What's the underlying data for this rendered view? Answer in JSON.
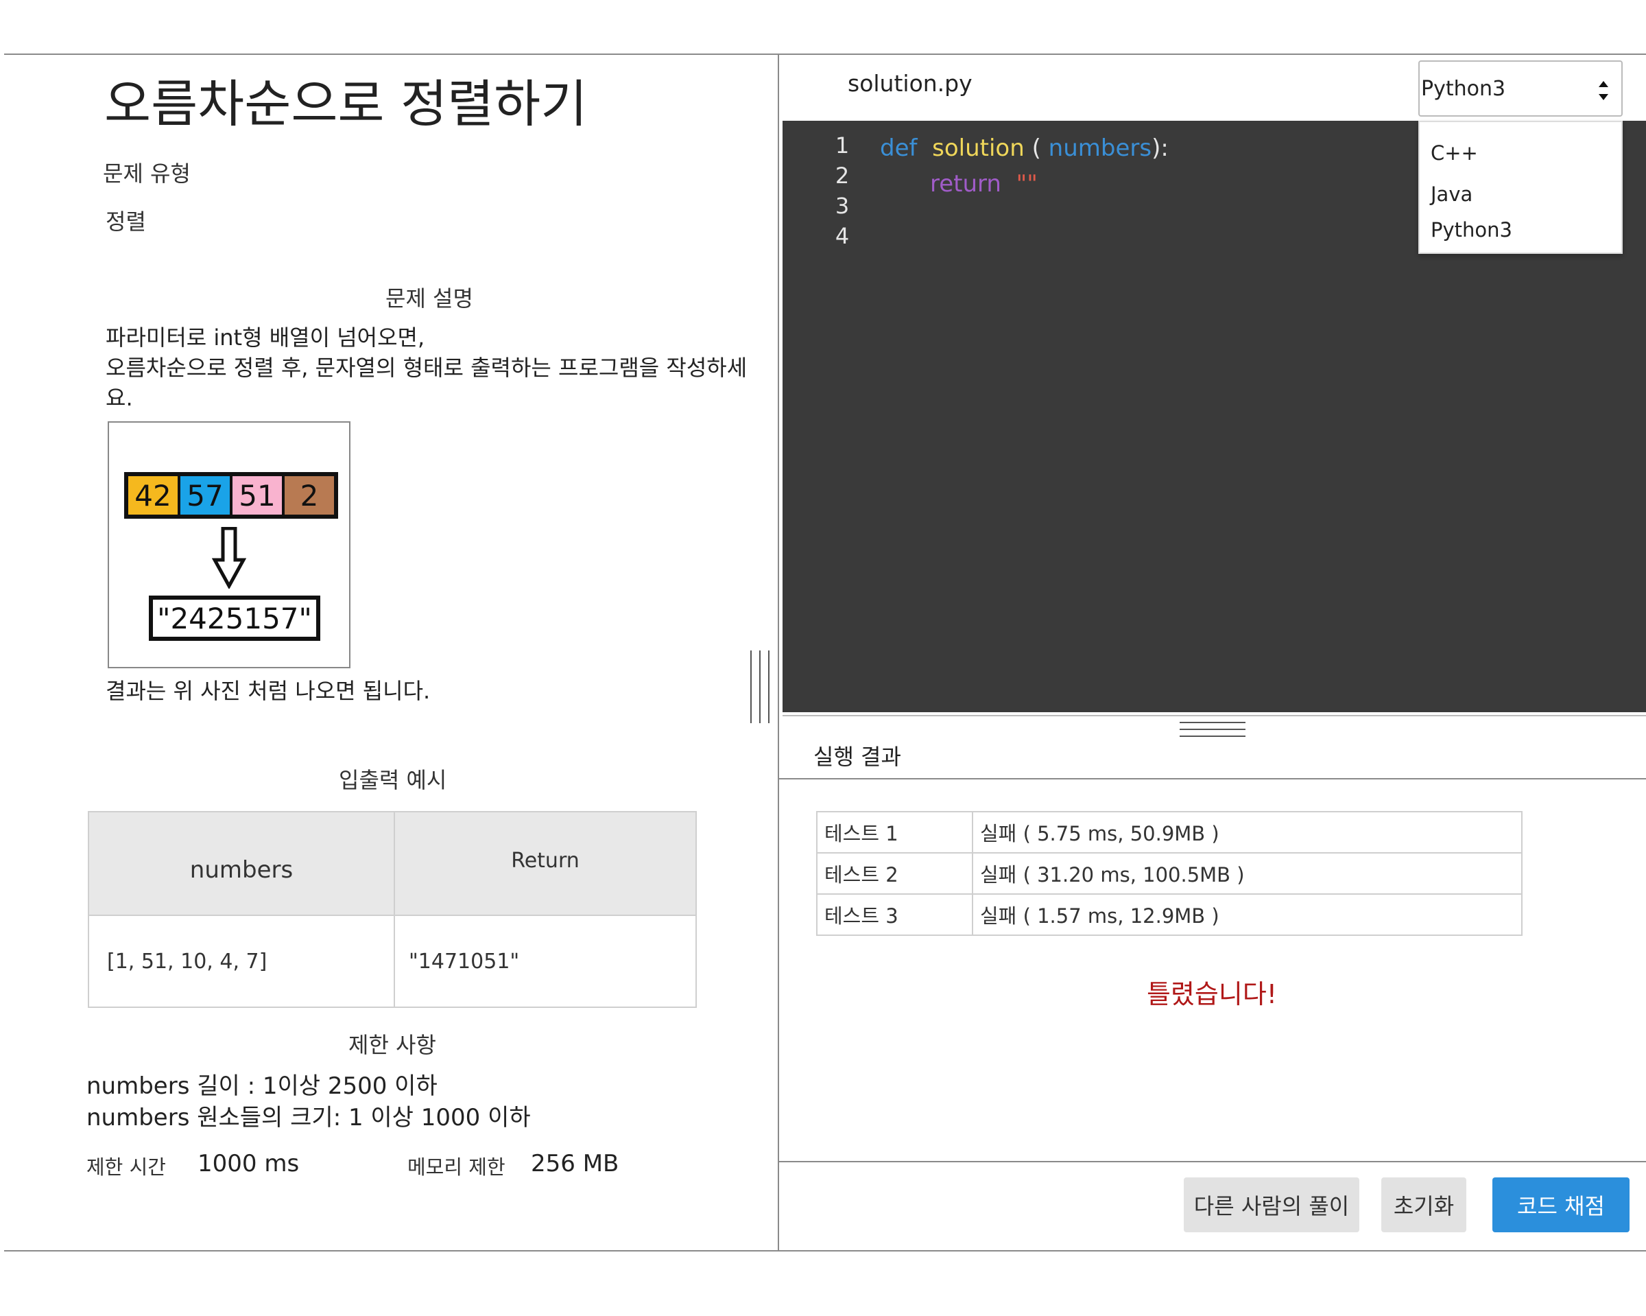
{
  "problem": {
    "title": "오름차순으로 정렬하기",
    "type_label": "문제 유형",
    "type_value": "정렬",
    "description_heading": "문제 설명",
    "description_lines": [
      "파라미터로 int형 배열이 넘어오면,",
      "오름차순으로 정렬 후, 문자열의 형태로 출력하는 프로그램을 작성하세",
      "요."
    ],
    "figure": {
      "array": [
        {
          "value": "42",
          "color": "#f5b81e"
        },
        {
          "value": "57",
          "color": "#1aa3e8"
        },
        {
          "value": "51",
          "color": "#f9b3cf"
        },
        {
          "value": "2",
          "color": "#b87a52"
        }
      ],
      "result": "\"2425157\""
    },
    "figure_note": "결과는 위 사진 처럼 나오면 됩니다.",
    "io_heading": "입출력 예시",
    "io_table": {
      "headers": [
        "numbers",
        "Return"
      ],
      "rows": [
        [
          "[1, 51, 10, 4, 7]",
          "\"1471051\""
        ]
      ]
    },
    "limits_heading": "제한 사항",
    "limits": [
      "numbers 길이 : 1이상 2500 이하",
      "numbers 원소들의 크기: 1 이상 1000 이하"
    ],
    "time_limit_label": "제한 시간",
    "time_limit_value": "1000 ms",
    "memory_limit_label": "메모리 제한",
    "memory_limit_value": "256 MB"
  },
  "editor": {
    "filename": "solution.py",
    "language": {
      "selected": "Python3",
      "options": [
        "C++",
        "Java",
        "Python3"
      ]
    },
    "line_numbers": [
      "1",
      "2",
      "3",
      "4"
    ],
    "code": {
      "kw_def": "def",
      "fn_name": "solution",
      "paren_open": "(",
      "param": "numbers",
      "paren_close": "):",
      "kw_return": "return",
      "string": "\"\""
    },
    "colors": {
      "background": "#3a3a3a",
      "keyword_def": "#3a8fd6",
      "function": "#f0d75a",
      "param": "#3a8fd6",
      "keyword_return": "#a05cc8",
      "string": "#e05a4a"
    }
  },
  "results": {
    "title": "실행 결과",
    "tests": [
      {
        "name": "테스트 1",
        "result": "실패 ( 5.75 ms, 50.9MB )"
      },
      {
        "name": "테스트 2",
        "result": "실패 ( 31.20 ms, 100.5MB )"
      },
      {
        "name": "테스트 3",
        "result": "실패 ( 1.57 ms, 12.9MB )"
      }
    ],
    "verdict": "틀렸습니다!",
    "verdict_color": "#b01818"
  },
  "actions": {
    "others_solution": "다른 사람의 풀이",
    "reset": "초기화",
    "submit": "코드 채점"
  }
}
